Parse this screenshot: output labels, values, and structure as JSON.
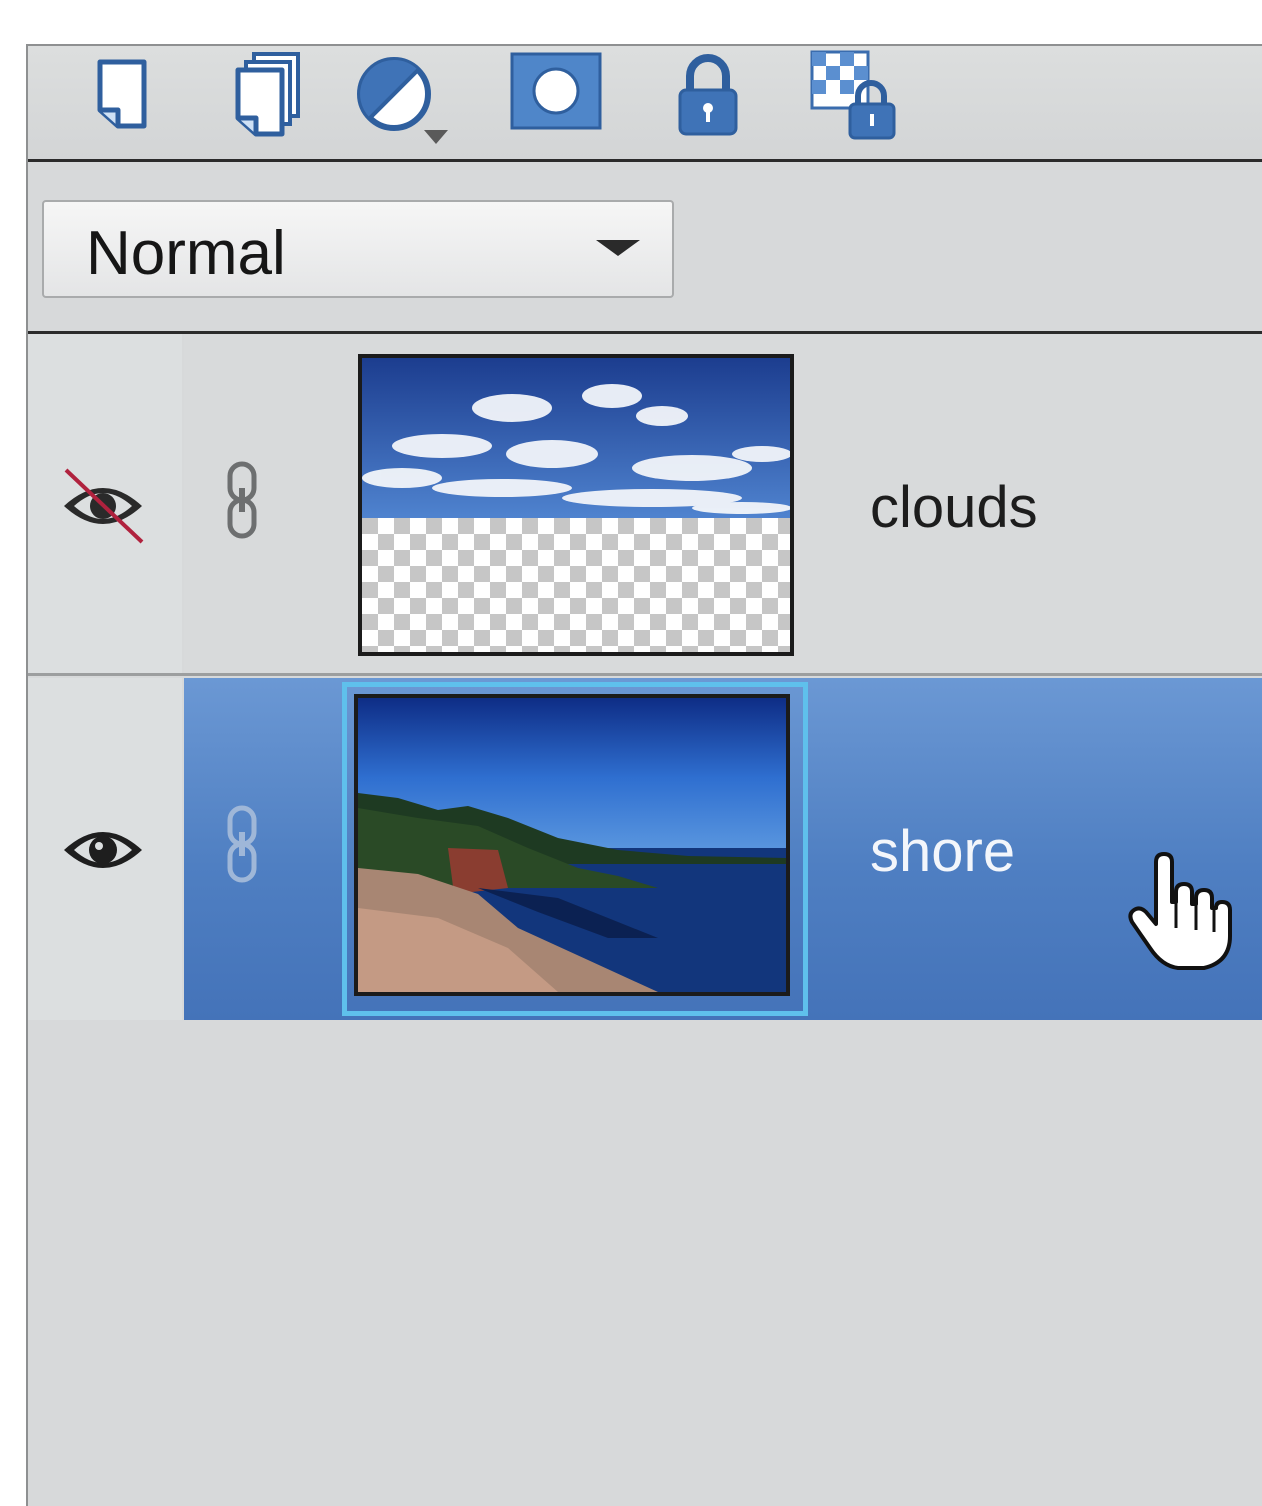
{
  "toolbar": {
    "buttons": [
      {
        "icon": "new-layer-icon"
      },
      {
        "icon": "new-group-icon"
      },
      {
        "icon": "adjustment-layer-icon"
      },
      {
        "icon": "layer-mask-icon"
      },
      {
        "icon": "lock-all-icon"
      },
      {
        "icon": "lock-transparency-icon"
      }
    ]
  },
  "blend_mode": {
    "value": "Normal"
  },
  "layers": [
    {
      "name": "clouds",
      "visible": false,
      "selected": false
    },
    {
      "name": "shore",
      "visible": true,
      "selected": true
    }
  ],
  "colors": {
    "selection": "#5584c5",
    "panel": "#d7d9da",
    "thumb_highlight": "#5fc0ec",
    "hidden_slash": "#b0223e"
  }
}
